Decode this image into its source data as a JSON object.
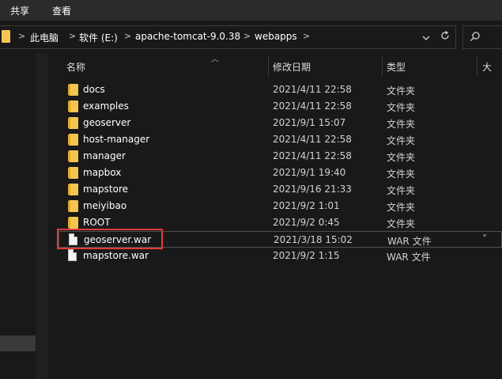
{
  "ribbon": {
    "tabs": [
      "共享",
      "查看"
    ]
  },
  "address": {
    "crumbs": [
      "此电脑",
      "软件 (E:)",
      "apache-tomcat-9.0.38",
      "webapps"
    ],
    "separator": ">",
    "dropdown_icon": "chevron-down-icon",
    "refresh_icon": "refresh-icon",
    "search_icon": "search-icon"
  },
  "columns": {
    "name": "名称",
    "date": "修改日期",
    "type": "类型",
    "size_truncated": "大"
  },
  "files": [
    {
      "name": "docs",
      "date": "2021/4/11 22:58",
      "type": "文件夹",
      "icon": "folder-icon"
    },
    {
      "name": "examples",
      "date": "2021/4/11 22:58",
      "type": "文件夹",
      "icon": "folder-icon"
    },
    {
      "name": "geoserver",
      "date": "2021/9/1 15:07",
      "type": "文件夹",
      "icon": "folder-icon"
    },
    {
      "name": "host-manager",
      "date": "2021/4/11 22:58",
      "type": "文件夹",
      "icon": "folder-icon"
    },
    {
      "name": "manager",
      "date": "2021/4/11 22:58",
      "type": "文件夹",
      "icon": "folder-icon"
    },
    {
      "name": "mapbox",
      "date": "2021/9/1 19:40",
      "type": "文件夹",
      "icon": "folder-icon"
    },
    {
      "name": "mapstore",
      "date": "2021/9/16 21:33",
      "type": "文件夹",
      "icon": "folder-icon"
    },
    {
      "name": "meiyibao",
      "date": "2021/9/2 1:01",
      "type": "文件夹",
      "icon": "folder-icon"
    },
    {
      "name": "ROOT",
      "date": "2021/9/2 0:45",
      "type": "文件夹",
      "icon": "folder-icon"
    },
    {
      "name": "geoserver.war",
      "date": "2021/3/18 15:02",
      "type": "WAR 文件",
      "icon": "file-icon"
    },
    {
      "name": "mapstore.war",
      "date": "2021/9/2 1:15",
      "type": "WAR 文件",
      "icon": "file-icon"
    }
  ],
  "colors": {
    "background": "#191919",
    "folder": "#f5c64f",
    "highlight": "#e03b3b"
  }
}
